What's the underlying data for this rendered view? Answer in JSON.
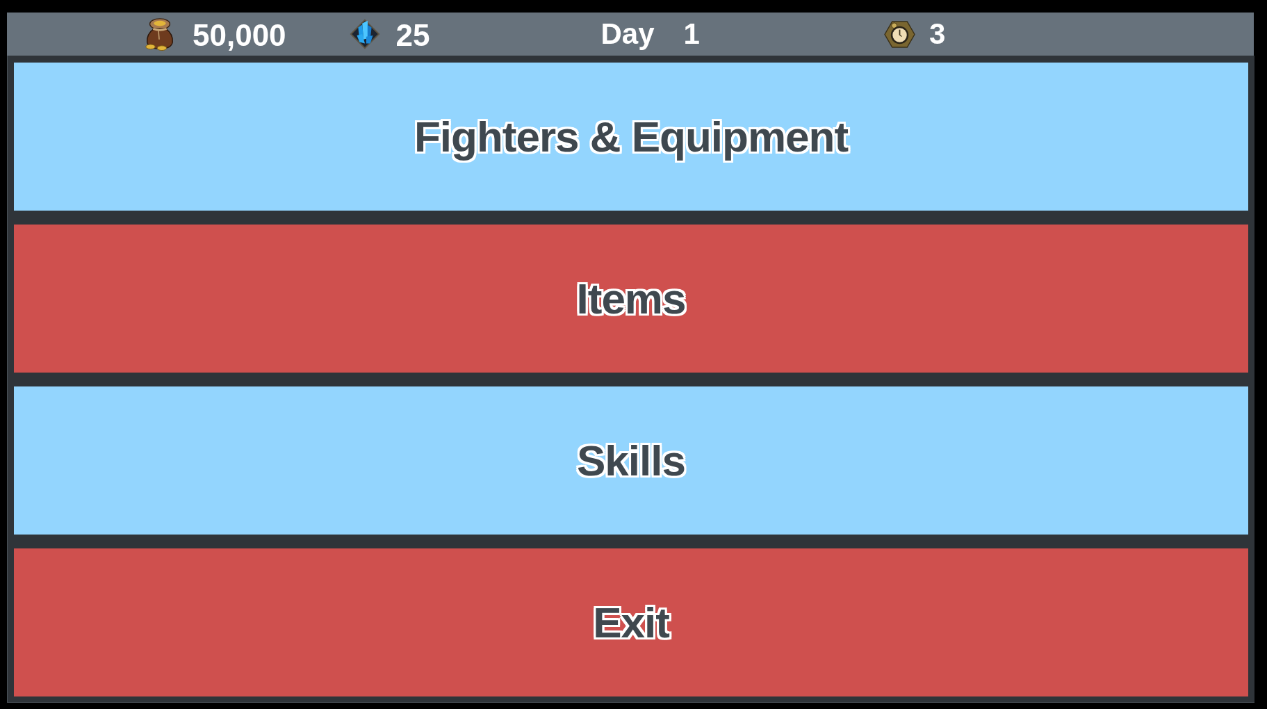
{
  "status_bar": {
    "gold": "50,000",
    "gems": "25",
    "day_label": "Day",
    "day": "1",
    "timers": "3"
  },
  "menu": [
    {
      "label": "Fighters & Equipment",
      "color": "#93d5fe"
    },
    {
      "label": "Items",
      "color": "#cf504e"
    },
    {
      "label": "Skills",
      "color": "#93d5fe"
    },
    {
      "label": "Exit",
      "color": "#cf504e"
    }
  ]
}
